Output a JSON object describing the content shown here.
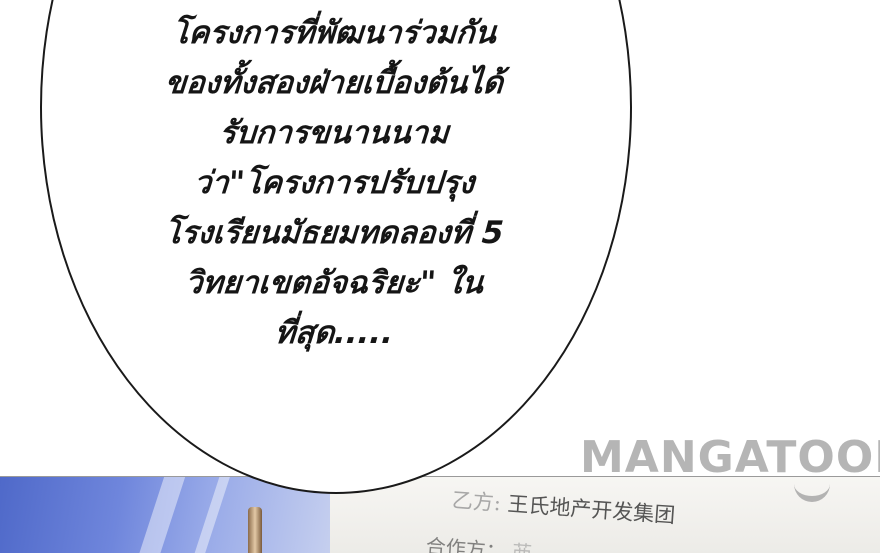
{
  "speech_bubble": {
    "lines": [
      "โครงการที่พัฒนาร่วมกัน",
      "ของทั้งสองฝ่ายเบื้องต้นได้",
      "รับการขนานนาม",
      "ว่า\"โครงการปรับปรุง",
      "โรงเรียนมัธยมทดลองที่ 5",
      "วิทยาเขตอัจฉริยะ\" ใน",
      "ที่สุด....."
    ]
  },
  "document": {
    "line_1_label": "乙方:",
    "line_1_value": "王氏地产开发集团",
    "line_2_label": "合作方：",
    "line_2_value": "䒼"
  },
  "watermark": {
    "text": "MANGATOON"
  },
  "colors": {
    "bubble_border": "#1a1a1a",
    "text": "#151515",
    "window_blue": "#6f86dc",
    "watermark": "#a0a0a0"
  }
}
